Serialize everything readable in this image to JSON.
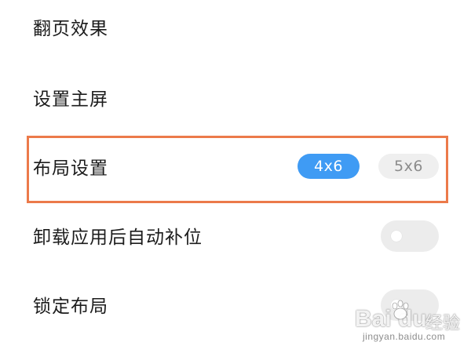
{
  "settings": {
    "rows": [
      {
        "label": "翻页效果"
      },
      {
        "label": "设置主屏"
      },
      {
        "label": "布局设置"
      },
      {
        "label": "卸载应用后自动补位"
      },
      {
        "label": "锁定布局"
      }
    ],
    "layout_options": {
      "active": "4x6",
      "inactive": "5x6"
    }
  },
  "watermark": {
    "logo": "Bai du",
    "suffix": "经验",
    "url": "jingyan.baidu.com"
  },
  "colors": {
    "highlight_border": "#ec7a4a",
    "active_pill": "#3f9bf4",
    "inactive_pill": "#efefef",
    "toggle_track": "#ececec"
  },
  "icons": {
    "watermark_paw": "paw-icon"
  }
}
